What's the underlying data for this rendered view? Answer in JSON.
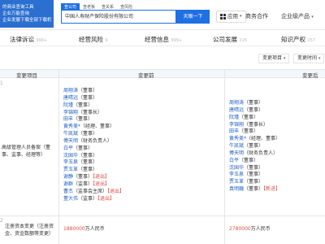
{
  "header": {
    "logo_lines": [
      "的商业查询工具",
      "企业万能查询",
      "企业发展下载全部下载机构"
    ],
    "search_tabs": [
      "查公司",
      "查老板",
      "查关系",
      "查风险"
    ],
    "search_value": "中国人寿财产保险股份有限公司",
    "search_button": "天眼一下",
    "app_label": "应用",
    "links": [
      "商务合作",
      "企业级产品"
    ]
  },
  "tabs": [
    {
      "label": "法律诉讼",
      "count": "999+"
    },
    {
      "label": "经营风险",
      "count": "9"
    },
    {
      "label": "经营信息",
      "count": "999+"
    },
    {
      "label": "公司发展",
      "count": "226"
    },
    {
      "label": "知识产权",
      "count": "257"
    }
  ],
  "filters": [
    "变更项目",
    "变更时间"
  ],
  "table": {
    "headers": [
      "变更项目",
      "变更前",
      "变更后"
    ],
    "rows": [
      {
        "index": "1",
        "type_lines": [
          "高级管理人员备案（董",
          "事、监事、经理等）"
        ],
        "before": [
          {
            "name": "周翔涛",
            "role": "（董事）",
            "tag": ""
          },
          {
            "name": "唐晴远",
            "role": "（董事）",
            "tag": ""
          },
          {
            "name": "阮瑾",
            "role": "（董事）",
            "tag": ""
          },
          {
            "name": "李锦翔",
            "role": "（董事长）",
            "tag": ""
          },
          {
            "name": "田丰",
            "role": "（董事）",
            "tag": ""
          },
          {
            "name": "黄秀美*",
            "role": "（经理、董事）",
            "tag": ""
          },
          {
            "name": "牛凯斌",
            "role": "（董事）",
            "tag": ""
          },
          {
            "name": "傅天明",
            "role": "（财务负责人）",
            "tag": ""
          },
          {
            "name": "白平",
            "role": "（董事）",
            "tag": ""
          },
          {
            "name": "沈国华",
            "role": "（董事）",
            "tag": ""
          },
          {
            "name": "李玉泉",
            "role": "（董事）",
            "tag": ""
          },
          {
            "name": "贾玉革",
            "role": "（董事）",
            "tag": ""
          },
          {
            "name": "谢静",
            "role": "（董事）",
            "tag": "【退出】"
          },
          {
            "name": "谢群",
            "role": "（监事）",
            "tag": "【退出】"
          },
          {
            "name": "曹杰",
            "role": "（监事会主席）",
            "tag": "【退出】"
          },
          {
            "name": "董大伟",
            "role": "（监事）",
            "tag": "【退出】"
          }
        ],
        "after": [
          {
            "name": "周翔涛",
            "role": "（董事）",
            "tag": ""
          },
          {
            "name": "唐晴远",
            "role": "（董事）",
            "tag": ""
          },
          {
            "name": "阮瑾",
            "role": "（董事）",
            "tag": ""
          },
          {
            "name": "李锦翔",
            "role": "（董事长）",
            "tag": ""
          },
          {
            "name": "田丰",
            "role": "（董事）",
            "tag": ""
          },
          {
            "name": "黄秀美*",
            "role": "（经理、董事）",
            "tag": ""
          },
          {
            "name": "牛凯斌",
            "role": "（董事）",
            "tag": ""
          },
          {
            "name": "傅天明",
            "role": "（财务负责人）",
            "tag": ""
          },
          {
            "name": "白平",
            "role": "（董事）",
            "tag": ""
          },
          {
            "name": "沈国华",
            "role": "（董事）",
            "tag": ""
          },
          {
            "name": "李玉泉",
            "role": "（董事）",
            "tag": ""
          },
          {
            "name": "贾玉革",
            "role": "（董事）",
            "tag": ""
          },
          {
            "name": "袁明巍",
            "role": "（董事）",
            "tag": "【新进】"
          }
        ]
      },
      {
        "index": "2",
        "type_lines": [
          "注册资本变更（注册资",
          "金、资金数额等变更）"
        ],
        "before_number": "1880000",
        "before_unit": "万人民币",
        "after_number": "2780000",
        "after_unit": "万人民币"
      }
    ]
  }
}
